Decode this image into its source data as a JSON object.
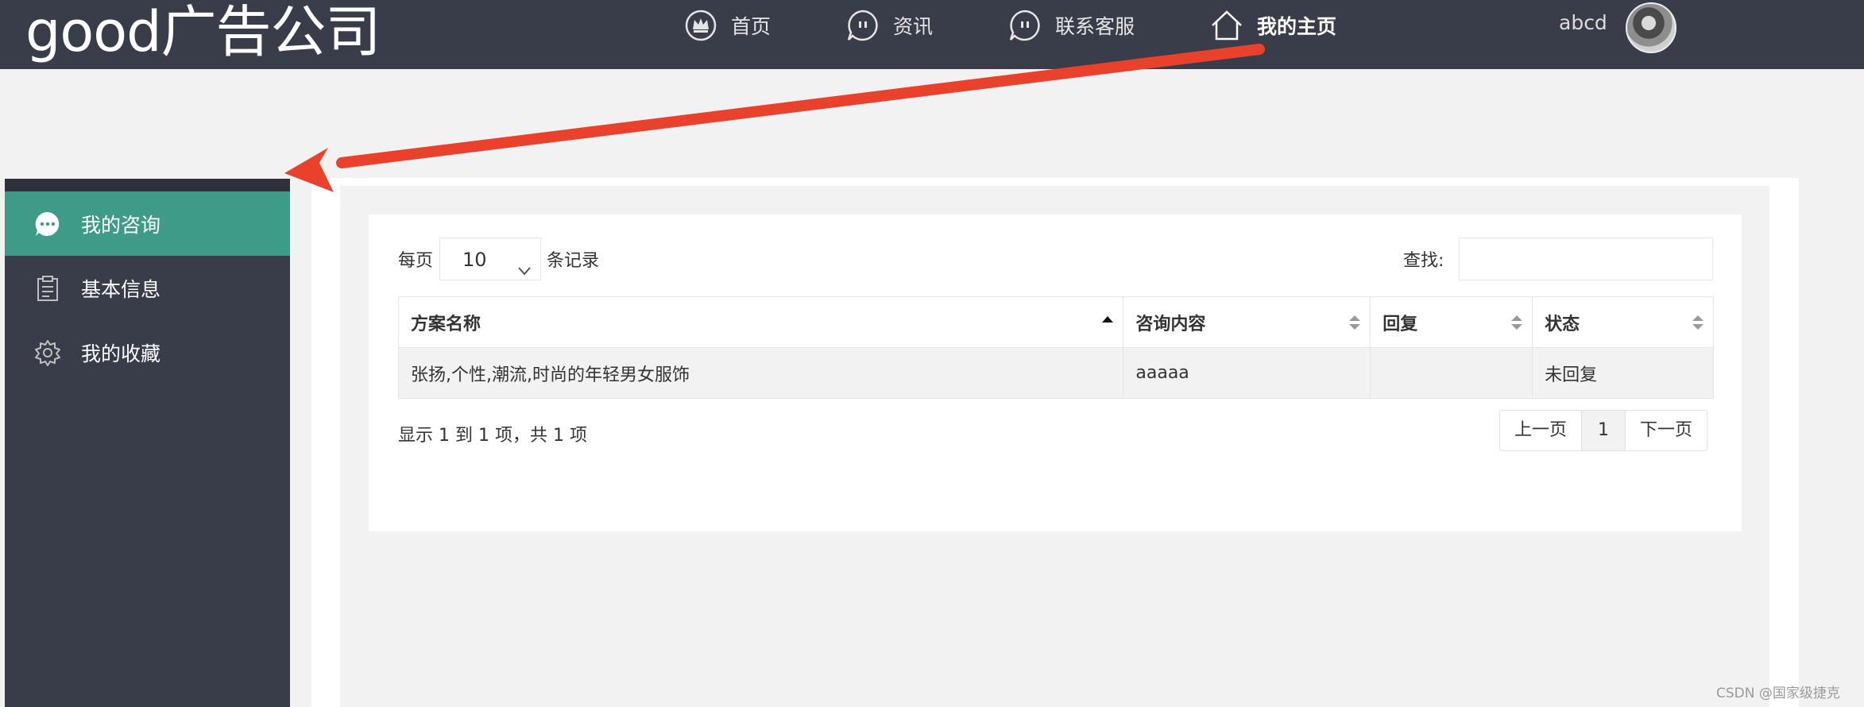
{
  "header": {
    "brand": "good广告公司",
    "nav": [
      {
        "label": "首页",
        "icon": "crown-icon"
      },
      {
        "label": "资讯",
        "icon": "chat-bubble-icon"
      },
      {
        "label": "联系客服",
        "icon": "chat-bubble-icon"
      },
      {
        "label": "我的主页",
        "icon": "home-icon"
      }
    ],
    "user": "abcd"
  },
  "sidebar": {
    "items": [
      {
        "label": "我的咨询",
        "icon": "chat-dots-icon"
      },
      {
        "label": "基本信息",
        "icon": "clipboard-icon"
      },
      {
        "label": "我的收藏",
        "icon": "gear-icon"
      }
    ]
  },
  "table_controls": {
    "per_page_prefix": "每页",
    "per_page_value": "10",
    "per_page_suffix": "条记录",
    "search_label": "查找:"
  },
  "table": {
    "columns": [
      "方案名称",
      "咨询内容",
      "回复",
      "状态"
    ],
    "rows": [
      [
        "张扬,个性,潮流,时尚的年轻男女服饰",
        "aaaaa",
        "",
        "未回复"
      ]
    ]
  },
  "footer": {
    "summary": "显示 1 到 1 项，共 1 项",
    "prev": "上一页",
    "page": "1",
    "next": "下一页"
  },
  "watermark": "CSDN @国家级捷克",
  "colors": {
    "topbar": "#393d49",
    "sidebar_active": "#3e9b88",
    "arrow": "#e8412c"
  }
}
